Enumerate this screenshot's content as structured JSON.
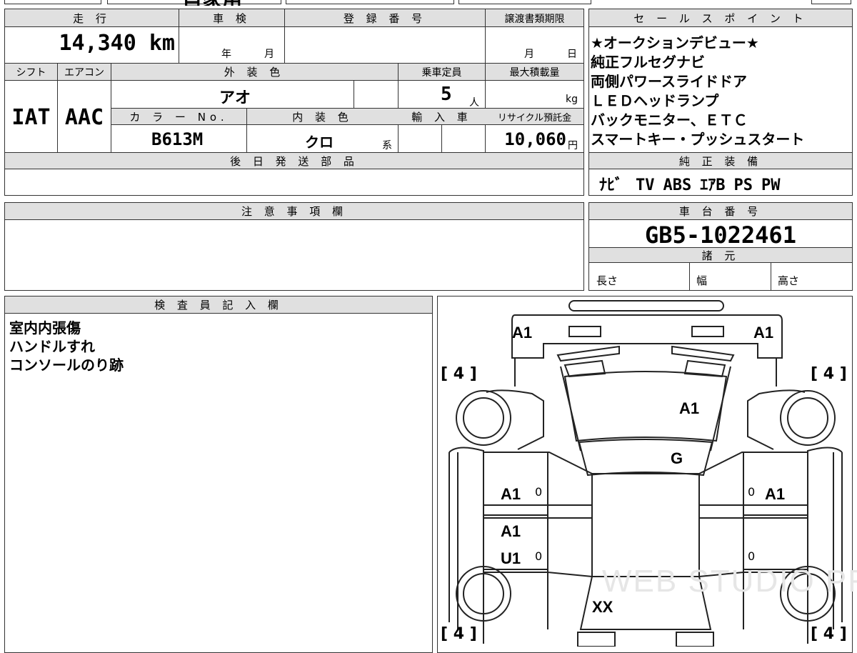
{
  "top_strip": {
    "partial_text": "自家用"
  },
  "vehicle": {
    "mileage_label": "走 行",
    "mileage_value": "14,340 km",
    "inspection_label": "車 検",
    "inspection_year_unit": "年",
    "inspection_month_unit": "月",
    "registration_label": "登 録 番 号",
    "registration_value": "",
    "transfer_deadline_label": "譲渡書類期限",
    "transfer_month_unit": "月",
    "transfer_day_unit": "日",
    "shift_label": "シフト",
    "shift_value": "IAT",
    "ac_label": "エアコン",
    "ac_value": "AAC",
    "exterior_label": "外 装 色",
    "exterior_value": "アオ",
    "capacity_label": "乗車定員",
    "capacity_value": "5",
    "capacity_unit": "人",
    "load_label": "最大積載量",
    "load_unit": "kg",
    "color_no_label": "カ ラ ー No.",
    "color_no_value": "B613M",
    "interior_label": "内 装 色",
    "interior_value": "クロ",
    "interior_suffix": "系",
    "import_label": "輸 入 車",
    "recycle_label": "リサイクル預託金",
    "recycle_value": "10,060",
    "recycle_unit": "円"
  },
  "later_parts": {
    "label": "後 日 発 送 部 品"
  },
  "notes": {
    "label": "注 意 事 項 欄"
  },
  "sales_points": {
    "label": "セ ー ル ス ポ イ ン ト",
    "items": [
      "★オークションデビュー★",
      "純正フルセグナビ",
      "両側パワースライドドア",
      "ＬＥＤヘッドランプ",
      "バックモニター、ＥＴＣ",
      "スマートキー・プッシュスタート"
    ]
  },
  "equipment": {
    "label": "純 正 装 備",
    "items": [
      "ﾅﾋﾞ",
      "TV",
      "ABS",
      "ｴｱB",
      "PS",
      "PW"
    ]
  },
  "chassis": {
    "label": "車 台 番 号",
    "value": "GB5-1022461"
  },
  "specs": {
    "label": "諸 元",
    "length": "長さ",
    "width": "幅",
    "height": "高さ"
  },
  "inspector": {
    "label": "検 査 員 記 入 欄",
    "lines": [
      "室内内張傷",
      "ハンドルすれ",
      "コンソールのり跡"
    ]
  },
  "diagram": {
    "front_left": "A1",
    "front_right": "A1",
    "hood": "A1",
    "windshield": "G",
    "front_door_left": "A1",
    "front_door_right": "A1",
    "rear_door_left_1": "A1",
    "rear_door_left_2": "U1",
    "rear_glass": "XX",
    "zero": "0",
    "tire_tread": "4",
    "watermark": "WEB STUDIO PRO"
  }
}
